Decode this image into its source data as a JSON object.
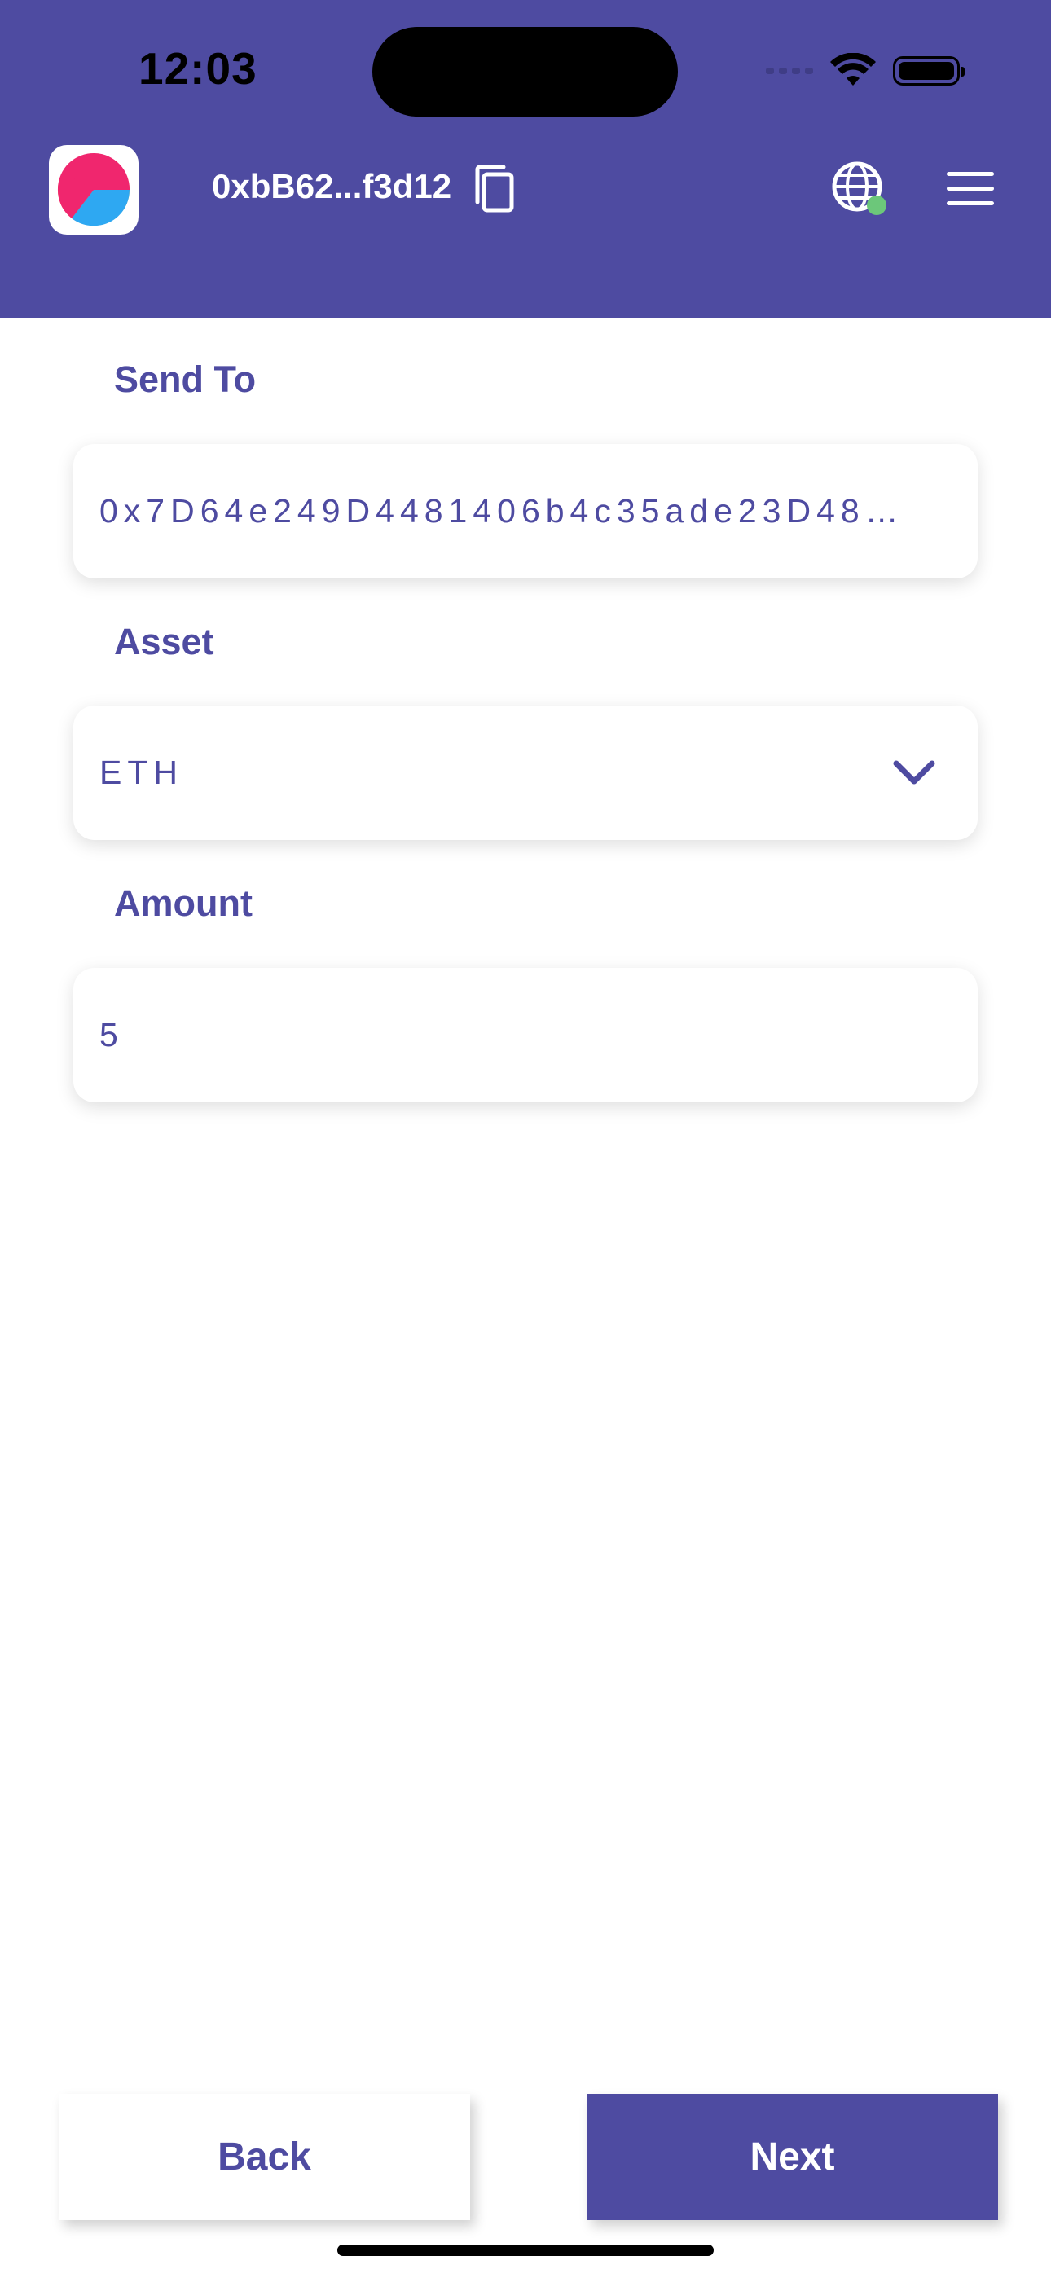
{
  "status_bar": {
    "time": "12:03"
  },
  "header": {
    "address": "0xbB62...f3d12",
    "logo_icon": "wallet-logo-icon",
    "copy_icon": "copy-icon",
    "network_icon": "globe-icon",
    "network_status_color": "#6cc77a",
    "menu_icon": "hamburger-menu-icon",
    "background_color": "#4e4ba1"
  },
  "form": {
    "send_to": {
      "label": "Send To",
      "value": "0x7D64e249D4481406b4c35ade23D48…"
    },
    "asset": {
      "label": "Asset",
      "value": "ETH"
    },
    "amount": {
      "label": "Amount",
      "value": "5"
    }
  },
  "actions": {
    "back_label": "Back",
    "next_label": "Next"
  },
  "colors": {
    "accent": "#4e4ba1",
    "background": "#ffffff"
  }
}
